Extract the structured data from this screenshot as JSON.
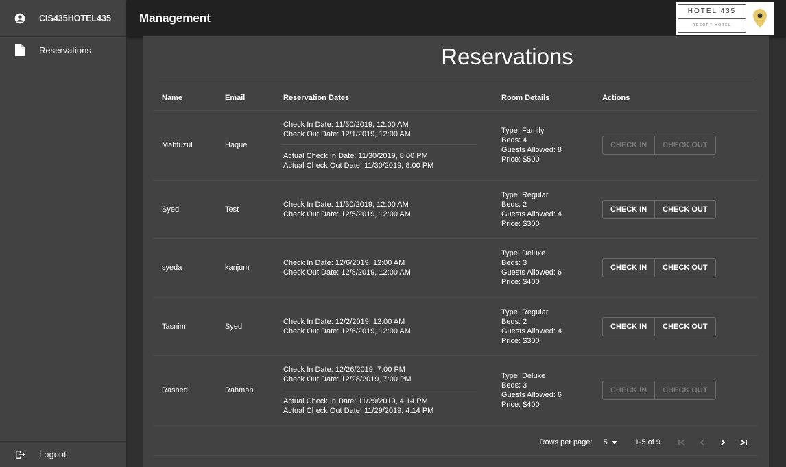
{
  "sidebar": {
    "user_label": "CIS435HOTEL435",
    "nav_items": [
      {
        "label": "Reservations"
      }
    ],
    "logout_label": "Logout"
  },
  "topbar": {
    "title": "Management",
    "logo": {
      "main": "HOTEL 435",
      "sub": "RESORT HOTEL",
      "pin_color": "#e8c96a"
    }
  },
  "page": {
    "heading": "Reservations",
    "columns": {
      "name": "Name",
      "email": "Email",
      "dates": "Reservation Dates",
      "room": "Room Details",
      "actions": "Actions"
    },
    "rows": [
      {
        "name": "Mahfuzul",
        "email": "Haque",
        "check_in": "Check In Date: 11/30/2019, 12:00 AM",
        "check_out": "Check Out Date: 12/1/2019, 12:00 AM",
        "actual_check_in": "Actual Check In Date: 11/30/2019, 8:00 PM",
        "actual_check_out": "Actual Check Out Date: 11/30/2019, 8:00 PM",
        "room_type": "Type: Family",
        "beds": "Beds: 4",
        "guests": "Guests Allowed: 8",
        "price": "Price: $500",
        "check_in_btn": "CHECK IN",
        "check_out_btn": "CHECK OUT",
        "disabled": true
      },
      {
        "name": "Syed",
        "email": "Test",
        "check_in": "Check In Date: 11/30/2019, 12:00 AM",
        "check_out": "Check Out Date: 12/5/2019, 12:00 AM",
        "room_type": "Type: Regular",
        "beds": "Beds: 2",
        "guests": "Guests Allowed: 4",
        "price": "Price: $300",
        "check_in_btn": "CHECK IN",
        "check_out_btn": "CHECK OUT",
        "disabled": false
      },
      {
        "name": "syeda",
        "email": "kanjum",
        "check_in": "Check In Date: 12/6/2019, 12:00 AM",
        "check_out": "Check Out Date: 12/8/2019, 12:00 AM",
        "room_type": "Type: Deluxe",
        "beds": "Beds: 3",
        "guests": "Guests Allowed: 6",
        "price": "Price: $400",
        "check_in_btn": "CHECK IN",
        "check_out_btn": "CHECK OUT",
        "disabled": false
      },
      {
        "name": "Tasnim",
        "email": "Syed",
        "check_in": "Check In Date: 12/2/2019, 12:00 AM",
        "check_out": "Check Out Date: 12/6/2019, 12:00 AM",
        "room_type": "Type: Regular",
        "beds": "Beds: 2",
        "guests": "Guests Allowed: 4",
        "price": "Price: $300",
        "check_in_btn": "CHECK IN",
        "check_out_btn": "CHECK OUT",
        "disabled": false
      },
      {
        "name": "Rashed",
        "email": "Rahman",
        "check_in": "Check In Date: 12/26/2019, 7:00 PM",
        "check_out": "Check Out Date: 12/28/2019, 7:00 PM",
        "actual_check_in": "Actual Check In Date: 11/29/2019, 4:14 PM",
        "actual_check_out": "Actual Check Out Date: 11/29/2019, 4:14 PM",
        "room_type": "Type: Deluxe",
        "beds": "Beds: 3",
        "guests": "Guests Allowed: 6",
        "price": "Price: $400",
        "check_in_btn": "CHECK IN",
        "check_out_btn": "CHECK OUT",
        "disabled": true
      }
    ],
    "pagination": {
      "rows_label": "Rows per page:",
      "rows_value": "5",
      "range": "1-5 of 9"
    }
  },
  "colors": {
    "sidebar_bg": "#424242",
    "topbar_bg": "#212121",
    "page_bg": "#303030",
    "panel_bg": "#424242",
    "disabled_text": "#767676"
  }
}
